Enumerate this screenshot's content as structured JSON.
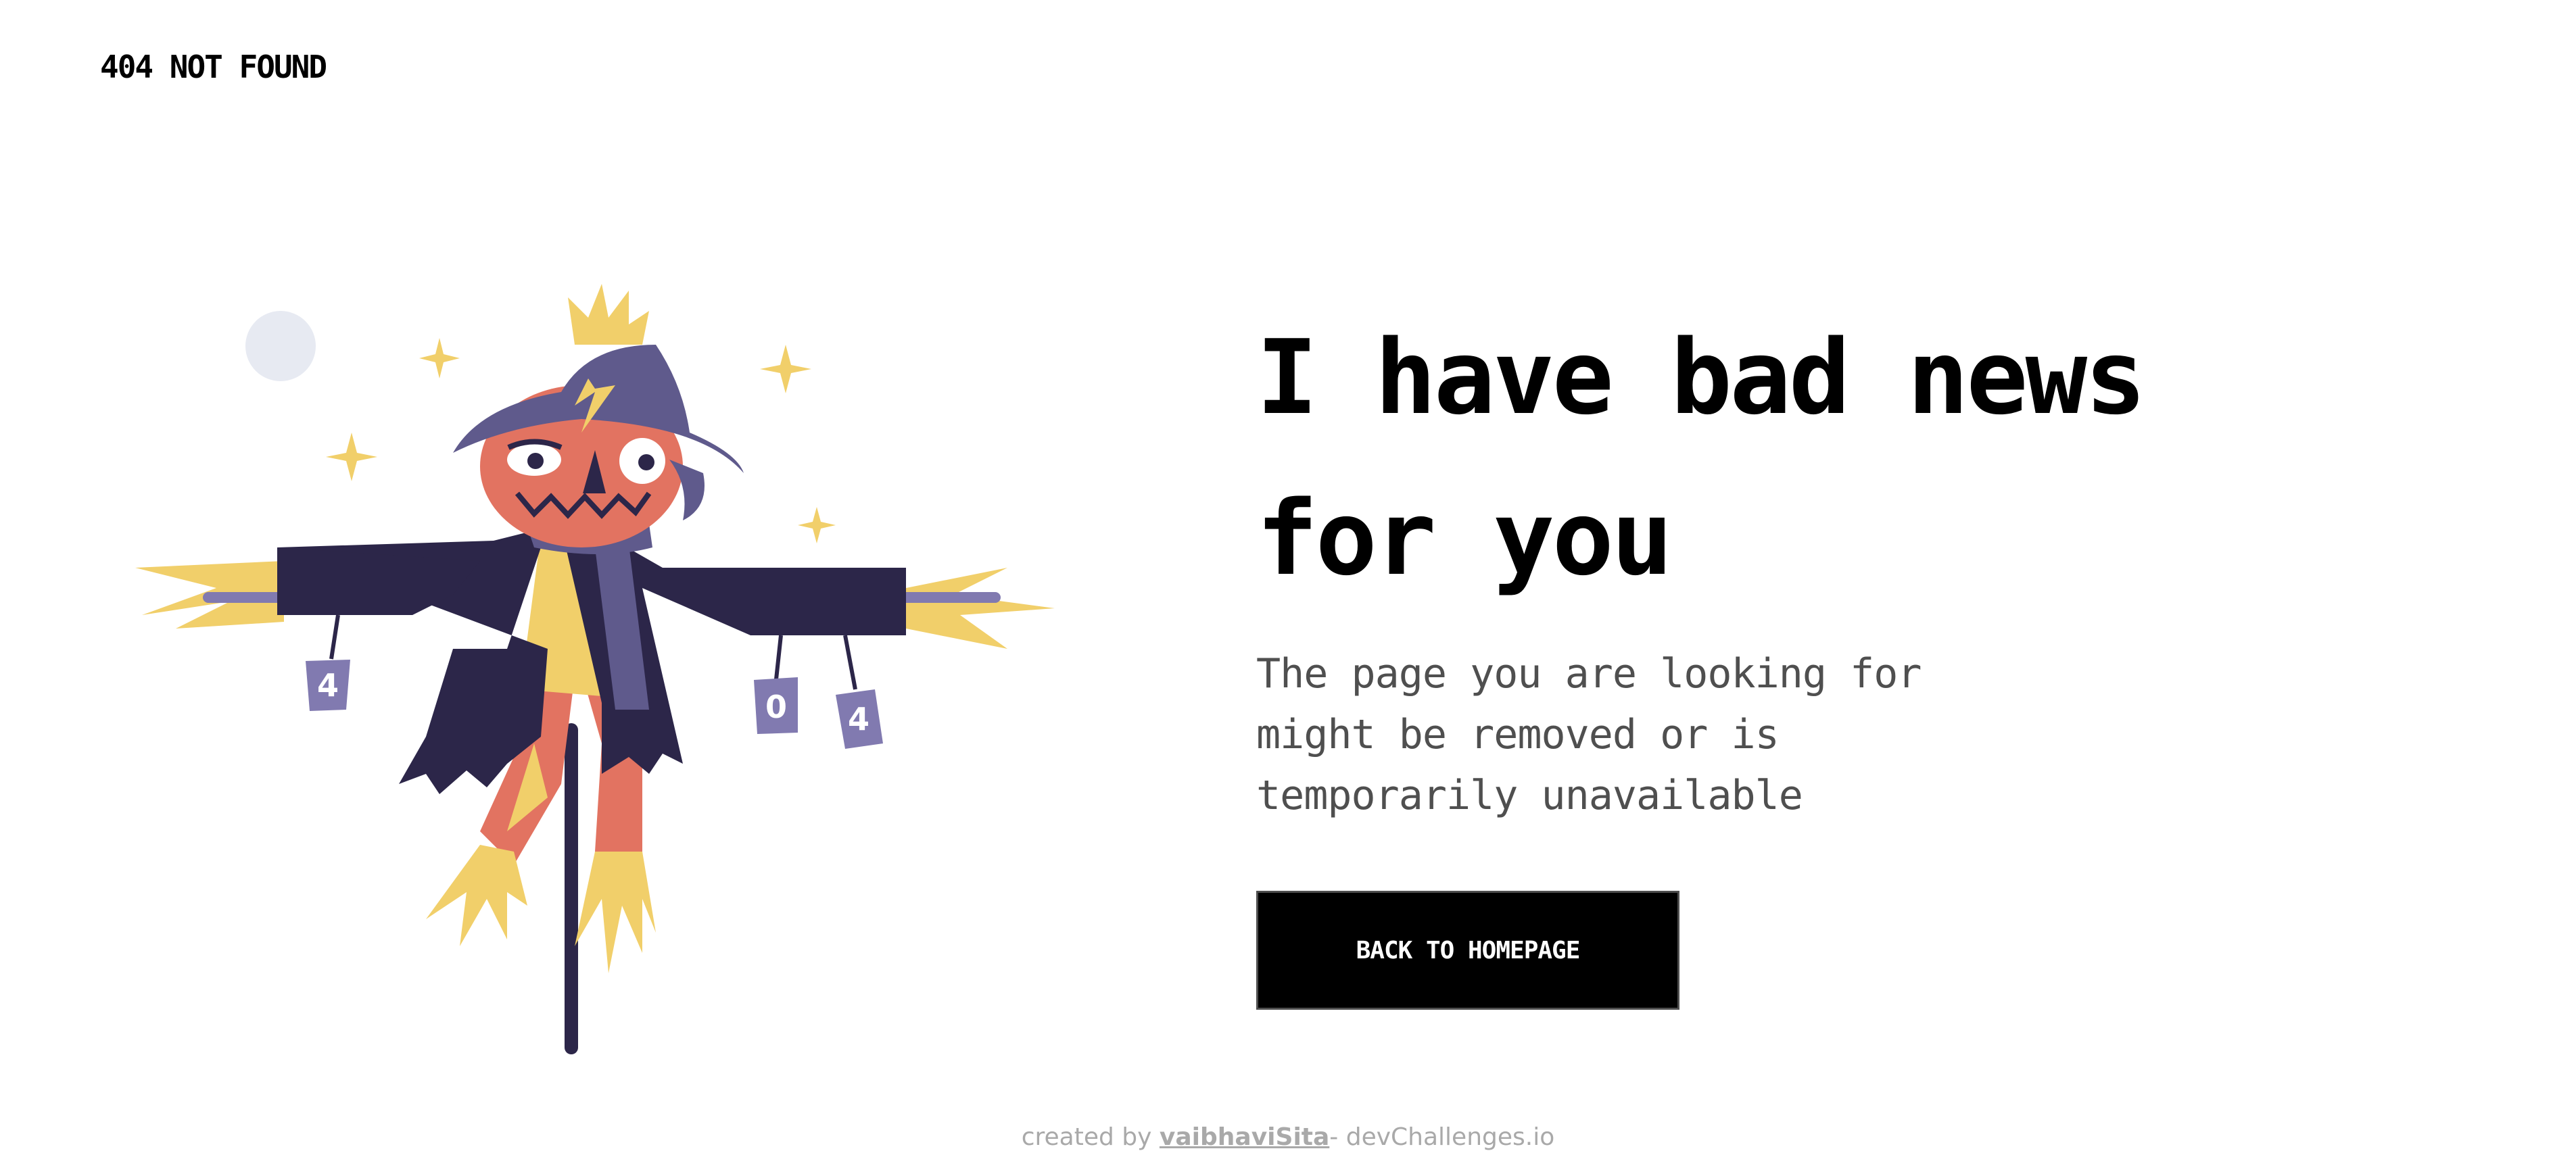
{
  "header": {
    "title": "404 NOT FOUND"
  },
  "illustration": {
    "name": "scarecrow",
    "cans": [
      "4",
      "0",
      "4"
    ]
  },
  "main": {
    "headline_line1": "I have bad news",
    "headline_line2": "for you",
    "description": "The page you are looking for might be removed or is temporarily unavailable",
    "button_label": "BACK TO HOMEPAGE"
  },
  "footer": {
    "prefix": "created by",
    "author": "vaibhaviSita",
    "suffix": "- devChallenges.io"
  },
  "colors": {
    "background": "#ffffff",
    "text": "#000000",
    "muted_text": "#4f4f4f",
    "footer_text": "#a9a9a9",
    "button_background": "#000000",
    "button_text": "#ffffff",
    "coat": "#2c2649",
    "hat": "#5f5a8c",
    "pumpkin": "#e27361",
    "straw": "#f1cf6a",
    "can": "#817ab0",
    "moon": "#e7eaf2"
  }
}
